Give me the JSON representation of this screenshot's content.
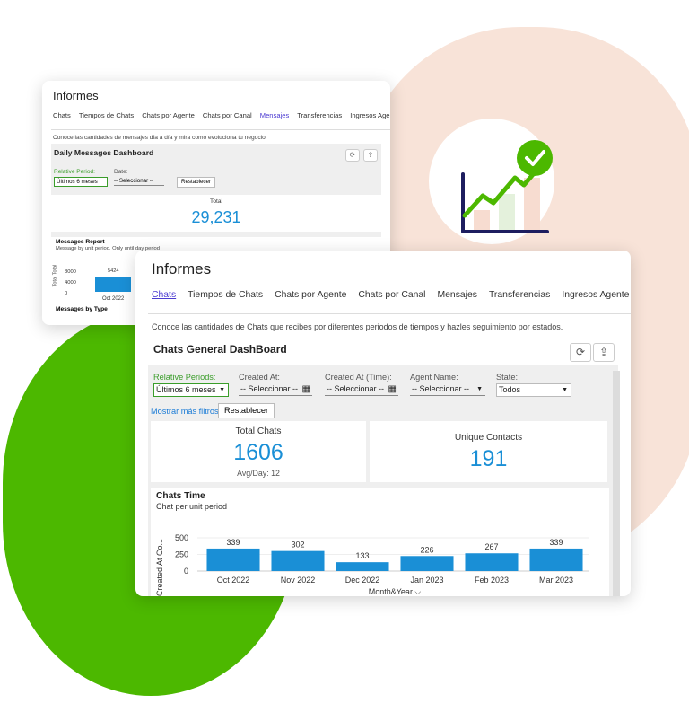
{
  "back_card": {
    "title": "Informes",
    "tabs": [
      "Chats",
      "Tiempos de Chats",
      "Chats por Agente",
      "Chats por Canal",
      "Mensajes",
      "Transferencias",
      "Ingresos Agente"
    ],
    "description": "Conoce las cantidades de mensajes día a día y mira como evoluciona tu negocio.",
    "dashboard_title": "Daily Messages Dashboard",
    "filters": {
      "relative_period_label": "Relative Period:",
      "relative_period_value": "Últimos 6 meses",
      "date_label": "Date:",
      "date_value": "-- Seleccionar --",
      "reset_label": "Restablecer"
    },
    "total": {
      "label": "Total",
      "value": "29,231"
    },
    "messages_report": {
      "title": "Messages Report",
      "subtitle": "Message by unit period. Only until day period",
      "y_axis": "Total Total",
      "ticks": [
        "8000",
        "4000",
        "0"
      ],
      "bar_value": "5424",
      "category": "Oct 2022"
    },
    "messages_by_type_title": "Messages by Type"
  },
  "front_card": {
    "title": "Informes",
    "tabs": [
      "Chats",
      "Tiempos de Chats",
      "Chats por Agente",
      "Chats por Canal",
      "Mensajes",
      "Transferencias",
      "Ingresos Agente"
    ],
    "description": "Conoce las cantidades de Chats que recibes por diferentes periodos de tiempos y hazles seguimiento por estados.",
    "dashboard_title": "Chats General DashBoard",
    "filters": {
      "relative_periods_label": "Relative Periods:",
      "relative_periods_value": "Últimos 6 meses",
      "created_at_label": "Created At:",
      "created_at_value": "-- Seleccionar --",
      "created_at_time_label": "Created At (Time):",
      "created_at_time_value": "-- Seleccionar --",
      "agent_name_label": "Agent Name:",
      "agent_name_value": "-- Seleccionar --",
      "state_label": "State:",
      "state_value": "Todos",
      "more_filters_label": "Mostrar más filtros",
      "reset_label": "Restablecer"
    },
    "total_chats": {
      "label": "Total Chats",
      "value": "1606",
      "sub": "Avg/Day: 12"
    },
    "unique_contacts": {
      "label": "Unique Contacts",
      "value": "191"
    }
  },
  "chart_data": {
    "type": "bar",
    "title": "Chats Time",
    "subtitle": "Chat per unit period",
    "xlabel": "Month&Year",
    "ylabel": "Created At Co...",
    "categories": [
      "Oct 2022",
      "Nov 2022",
      "Dec 2022",
      "Jan 2023",
      "Feb 2023",
      "Mar 2023"
    ],
    "values": [
      339,
      302,
      133,
      226,
      267,
      339
    ],
    "y_ticks": [
      500,
      250,
      0
    ],
    "ylim": [
      0,
      500
    ],
    "bar_color": "#1a8fd6"
  },
  "colors": {
    "accent": "#1a8fd6",
    "active_tab": "#4b3ad1",
    "green": "#4cb800",
    "peach": "#f8e3d8"
  },
  "icons": {
    "growth_chart": "growth-chart-icon",
    "check": "check-icon"
  }
}
